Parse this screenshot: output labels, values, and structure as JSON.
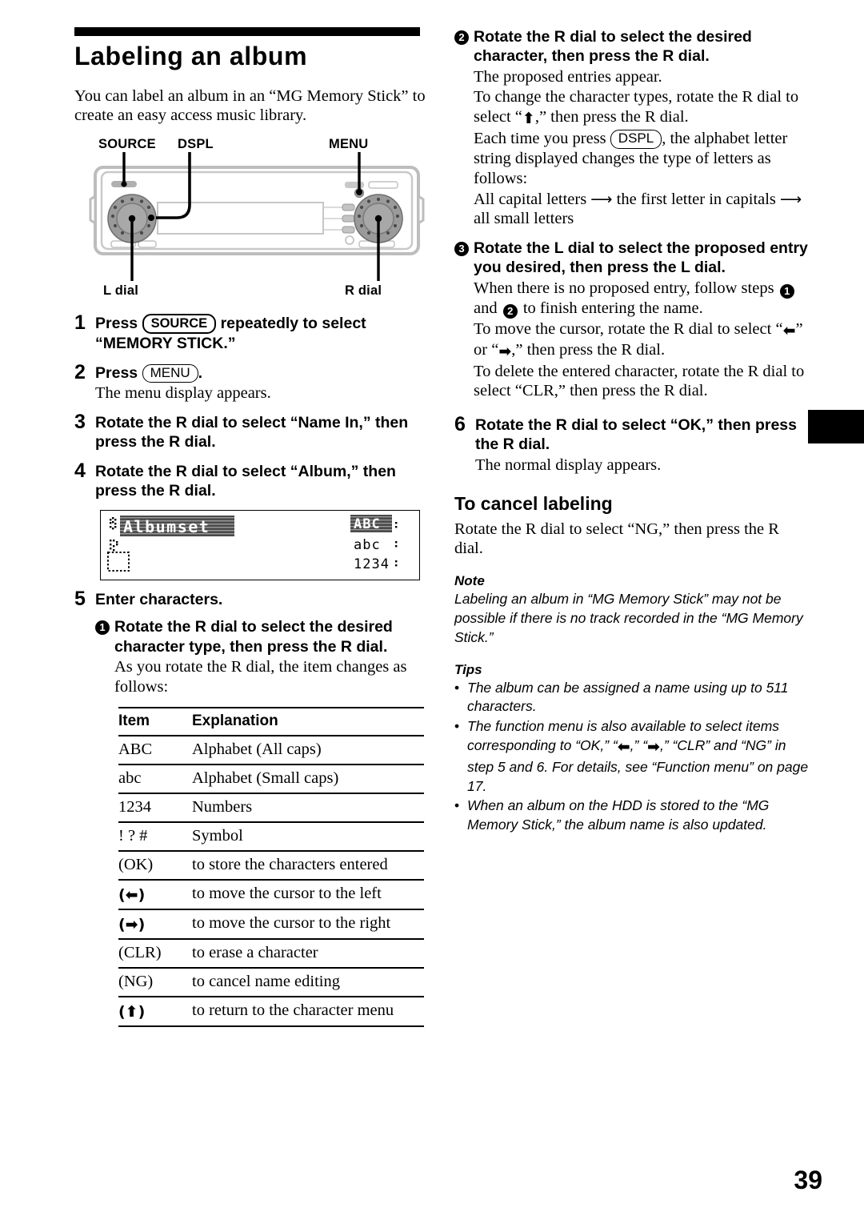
{
  "page": {
    "title": "Labeling an album",
    "folio": "39"
  },
  "intro": "You can label an album in an “MG Memory Stick” to create an easy access music library.",
  "figure": {
    "callouts": {
      "source": "SOURCE",
      "dspl": "DSPL",
      "menu": "MENU",
      "l_dial": "L dial",
      "r_dial": "R dial"
    }
  },
  "lcd": {
    "main_text": "Albumset",
    "char_types": [
      "ABC",
      "abc",
      "1234"
    ],
    "selected_char_type": "ABC"
  },
  "steps": [
    {
      "num": "1",
      "head_pre": "Press",
      "button": "SOURCE",
      "head_post": "repeatedly to select “MEMORY STICK.”"
    },
    {
      "num": "2",
      "head_pre": "Press",
      "button": "MENU",
      "head_post": ".",
      "sub": "The menu display appears."
    },
    {
      "num": "3",
      "head": "Rotate the R dial to select “Name In,” then press the R dial."
    },
    {
      "num": "4",
      "head": "Rotate the R dial to select “Album,” then press the R dial."
    },
    {
      "num": "5",
      "head": "Enter characters."
    },
    {
      "num": "6",
      "head": "Rotate the R dial to select “OK,” then press the R dial.",
      "sub": "The normal display appears."
    }
  ],
  "substeps": [
    {
      "num": "1",
      "head": "Rotate the R dial to select the desired character type, then press the R dial.",
      "sub": "As you rotate the R dial, the item changes as follows:"
    },
    {
      "num": "2",
      "head": "Rotate the R dial to select the desired character, then press the R dial.",
      "sub_lines": [
        "The proposed entries appear.",
        "To change the character types, rotate the R dial to select “↑,” then press the R dial.",
        "Each time you press (DSPL), the alphabet letter string displayed changes the type of letters as follows:",
        "All capital letters → the first letter in capitals → all small letters"
      ],
      "dspl_button": "DSPL"
    },
    {
      "num": "3",
      "head": "Rotate the L dial to select the proposed entry you desired, then press the L dial.",
      "sub_lines": [
        "When there is no proposed entry, follow steps 1 and 2 to finish entering the name.",
        "To move the cursor, rotate the R dial to select “←” or “→,” then press the R dial.",
        "To delete the entered character, rotate the R dial to select “CLR,” then press the R dial."
      ]
    }
  ],
  "table": {
    "headers": [
      "Item",
      "Explanation"
    ],
    "rows": [
      {
        "item": "ABC",
        "explanation": "Alphabet (All caps)"
      },
      {
        "item": "abc",
        "explanation": "Alphabet (Small caps)"
      },
      {
        "item": "1234",
        "explanation": "Numbers"
      },
      {
        "item": "! ? #",
        "explanation": "Symbol"
      },
      {
        "item": "(OK)",
        "explanation": "to store the characters entered"
      },
      {
        "item": "(←)",
        "explanation": "to move the cursor to the left"
      },
      {
        "item": "(→)",
        "explanation": "to move the cursor to the right"
      },
      {
        "item": "(CLR)",
        "explanation": "to erase a character"
      },
      {
        "item": "(NG)",
        "explanation": "to cancel name editing"
      },
      {
        "item": "(↑)",
        "explanation": "to return to the character menu"
      }
    ]
  },
  "cancel_section": {
    "head": "To cancel labeling",
    "body": "Rotate the R dial to select “NG,” then press the R dial."
  },
  "note": {
    "head": "Note",
    "body": "Labeling an album in “MG Memory Stick” may not be possible if there is no track recorded in the “MG Memory Stick.”"
  },
  "tips": {
    "head": "Tips",
    "items": [
      "The album can be assigned a name using up to 511 characters.",
      "The function menu is also available to select items corresponding to “OK,” “←,” “→,” “CLR” and “NG” in step 5 and 6. For details, see “Function menu” on page 17.",
      "When an album on the HDD is stored to the “MG Memory Stick,” the album name is also updated."
    ]
  }
}
